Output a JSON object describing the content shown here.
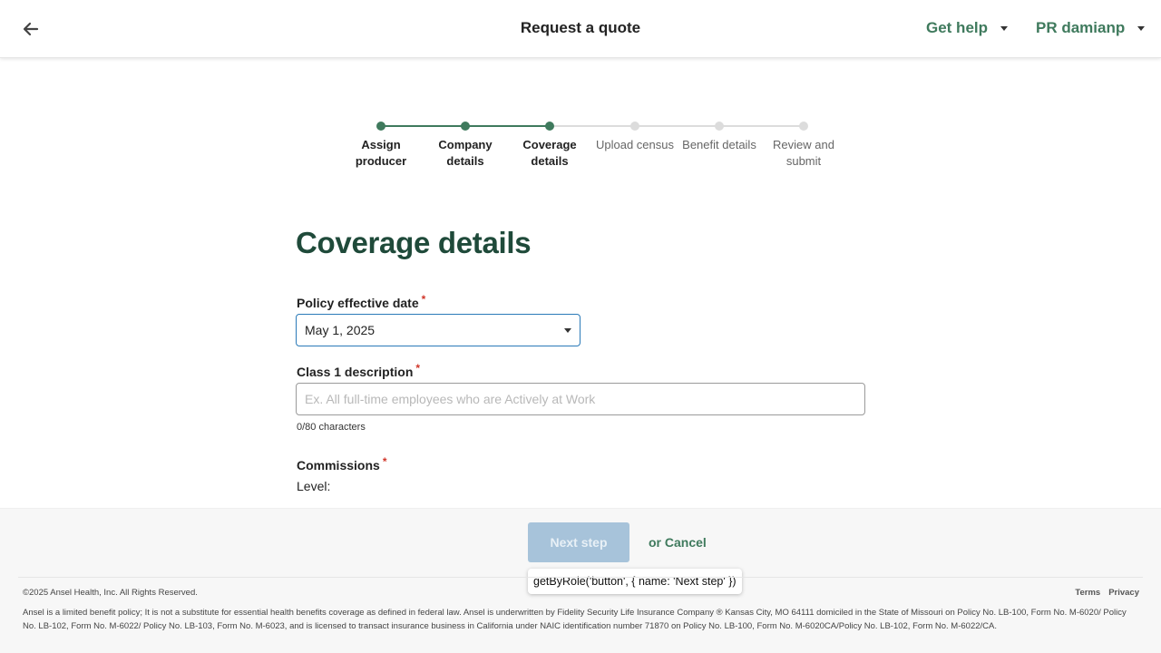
{
  "header": {
    "title": "Request a quote",
    "help_label": "Get help",
    "user_label": "PR damianp"
  },
  "stepper": {
    "steps": [
      {
        "label": "Assign producer",
        "state": "done"
      },
      {
        "label": "Company details",
        "state": "done"
      },
      {
        "label": "Coverage details",
        "state": "current"
      },
      {
        "label": "Upload census",
        "state": "todo"
      },
      {
        "label": "Benefit details",
        "state": "todo"
      },
      {
        "label": "Review and submit",
        "state": "todo"
      }
    ]
  },
  "main": {
    "heading": "Coverage details",
    "effective_date": {
      "label": "Policy effective date",
      "required": "*",
      "value": "May 1, 2025"
    },
    "class_description": {
      "label": "Class 1 description",
      "required": "*",
      "placeholder": "Ex. All full-time employees who are Actively at Work",
      "char_count": "0/80 characters"
    },
    "commissions": {
      "label": "Commissions",
      "required": "*",
      "level_label": "Level:"
    }
  },
  "actions": {
    "next_label": "Next step",
    "cancel_label": "or Cancel",
    "tooltip": "getByRole('button', { name: 'Next step' })"
  },
  "footer": {
    "copyright": "©2025 Ansel Health, Inc. All Rights Reserved.",
    "terms": "Terms",
    "privacy": "Privacy",
    "disclaimer": "Ansel is a limited benefit policy; It is not a substitute for essential health benefits coverage as defined in federal law. Ansel is underwritten by Fidelity Security Life Insurance Company ® Kansas City, MO 64111 domiciled in the State of Missouri on Policy No. LB-100, Form No. M-6020/ Policy No. LB-102, Form No. M-6022/ Policy No. LB-103, Form No. M-6023, and is licensed to transact insurance business in California under NAIC identification number 71870 on Policy No. LB-100, Form No. M-6020CA/Policy No. LB-102, Form No. M-6022/CA."
  },
  "colors": {
    "brand_green": "#3f7a5d",
    "heading_green": "#1f4a3a",
    "required_red": "#d0362a",
    "focus_blue": "#2a7ab8",
    "disabled_button": "#a7c3da"
  },
  "icons": {
    "back": "arrow-left-icon",
    "dropdown": "caret-down-icon"
  }
}
